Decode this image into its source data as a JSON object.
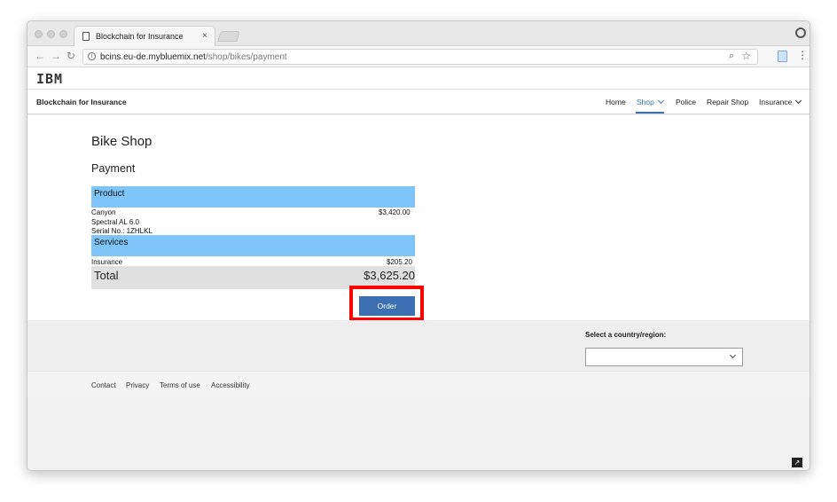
{
  "browser": {
    "tab_title": "Blockchain for Insurance",
    "tab_close": "×",
    "url_host": "bcins.eu-de.mybluemix.net",
    "url_path": "/shop/bikes/payment"
  },
  "ibm_logo": "IBM",
  "masthead": {
    "brand": "Blockchain for Insurance",
    "nav": {
      "home": "Home",
      "shop": "Shop",
      "police": "Police",
      "repair_shop": "Repair Shop",
      "insurance": "Insurance"
    }
  },
  "page": {
    "title": "Bike Shop",
    "subtitle": "Payment",
    "product_header": "Product",
    "product_lines": [
      "Canyon",
      "Spectral AL 6.0",
      "Serial No.: 1ZHLKL"
    ],
    "product_price": "$3,420.00",
    "services_header": "Services",
    "service_name": "Insurance",
    "service_price": "$205.20",
    "total_label": "Total",
    "total_value": "$3,625.20",
    "order_button": "Order"
  },
  "footer": {
    "country_label": "Select a country/region:",
    "country_value": "",
    "links": [
      "Contact",
      "Privacy",
      "Terms of use",
      "Accessibility"
    ]
  },
  "colors": {
    "accent": "#3d70b2",
    "section_header": "#7fc4f8",
    "highlight_frame": "#ff0000"
  }
}
